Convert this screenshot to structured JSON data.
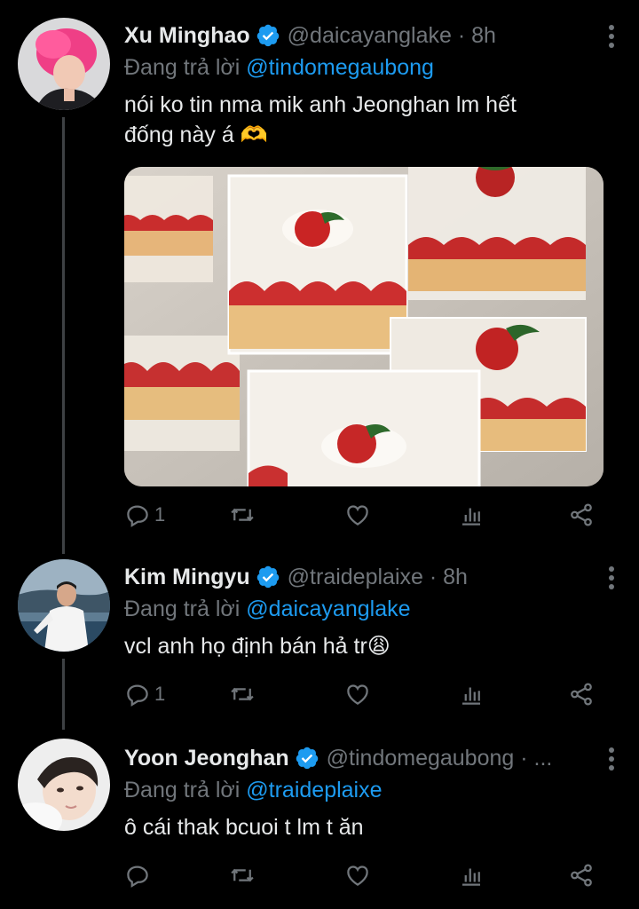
{
  "colors": {
    "background": "#000000",
    "text": "#e7e9ea",
    "muted": "#71767b",
    "link": "#1d9bf0",
    "thread_line": "#3e4144"
  },
  "tweets": [
    {
      "name": "Xu Minghao",
      "handle": "@daicayanglake · 8h",
      "reply_prefix": "Đang trả lời ",
      "reply_to": "@tindomegaubong",
      "text_line1": "nói ko tin nma mik anh Jeonghan lm hết",
      "text_line2": "đống này á 🫶",
      "reply_count": "1",
      "has_media": true,
      "media_icon": "strawberry-cake-photo"
    },
    {
      "name": "Kim Mingyu",
      "handle": "@traideplaixe · 8h",
      "reply_prefix": "Đang trả lời ",
      "reply_to": "@daicayanglake",
      "text": "vcl anh họ định bán hả tr😩",
      "reply_count": "1"
    },
    {
      "name": "Yoon Jeonghan",
      "handle": "@tindomegaubong · ...",
      "reply_prefix": "Đang trả lời ",
      "reply_to": "@traideplaixe",
      "text": "ô cái thak bcuoi t lm t ăn",
      "reply_count": ""
    }
  ]
}
